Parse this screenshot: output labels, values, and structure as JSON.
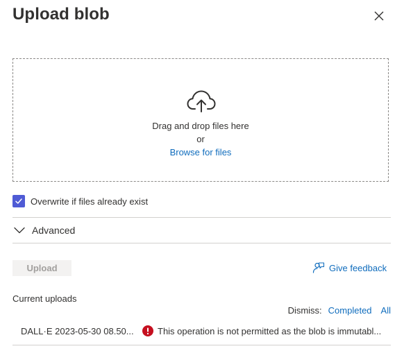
{
  "panel": {
    "title": "Upload blob"
  },
  "dropzone": {
    "drag_text": "Drag and drop files here",
    "or_text": "or",
    "browse_link": "Browse for files"
  },
  "overwrite": {
    "label": "Overwrite if files already exist",
    "checked": true
  },
  "advanced": {
    "label": "Advanced",
    "expanded": false
  },
  "actions": {
    "upload_label": "Upload",
    "upload_enabled": false,
    "feedback_label": "Give feedback"
  },
  "current_uploads": {
    "heading": "Current uploads",
    "dismiss_label": "Dismiss:",
    "dismiss_completed": "Completed",
    "dismiss_all": "All",
    "items": [
      {
        "file": "DALL·E 2023-05-30 08.50...",
        "status": "error",
        "message": "This operation is not permitted as the blob is immutabl..."
      }
    ]
  },
  "colors": {
    "accent": "#4f5bd5",
    "link": "#0f6cbd",
    "error": "#c50f1f",
    "text": "#323130"
  },
  "icons": [
    "close-icon",
    "cloud-upload-icon",
    "checkmark-icon",
    "chevron-down-icon",
    "feedback-icon",
    "error-icon"
  ]
}
